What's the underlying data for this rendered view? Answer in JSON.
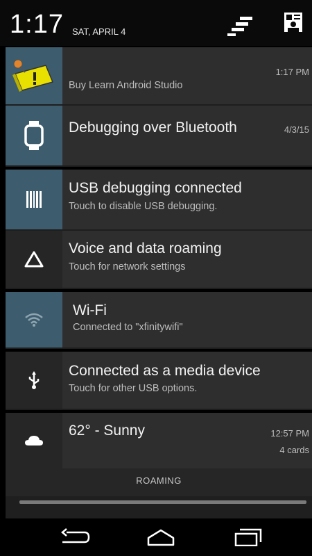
{
  "status_bar": {
    "time": "1:17",
    "date": "SAT, APRIL 4",
    "icons": [
      "quick-settings-icon",
      "user-profile-icon"
    ]
  },
  "notifications": [
    {
      "id": "buy",
      "title": "",
      "subtitle": "Buy Learn Android Studio",
      "time": "1:17 PM",
      "icon": "label-tag-icon",
      "icon_bg": "#3d5d6e"
    },
    {
      "id": "bt-debug",
      "title": "Debugging over Bluetooth",
      "subtitle": "",
      "time": "4/3/15",
      "icon": "smartwatch-icon",
      "icon_bg": "#3d5d6e"
    },
    {
      "id": "usb-debug",
      "title": "USB debugging connected",
      "subtitle": "Touch to disable USB debugging.",
      "time": "",
      "icon": "barcode-icon",
      "icon_bg": "#3d5d6e"
    },
    {
      "id": "roaming",
      "title": "Voice and data roaming",
      "subtitle": "Touch for network settings",
      "time": "",
      "icon": "warning-triangle-icon",
      "icon_bg": "#262626"
    },
    {
      "id": "wifi",
      "title": "Wi-Fi",
      "subtitle": "Connected to \"xfinitywifi\"",
      "time": "",
      "icon": "wifi-icon",
      "icon_bg": "#3d5d6e"
    },
    {
      "id": "media",
      "title": "Connected as a media device",
      "subtitle": "Touch for other USB options.",
      "time": "",
      "icon": "usb-icon",
      "icon_bg": "#262626"
    },
    {
      "id": "weather",
      "title": "62° - Sunny",
      "subtitle": "",
      "time": "12:57 PM",
      "extra": "4 cards",
      "icon": "cloud-icon",
      "icon_bg": "#262626"
    }
  ],
  "footer": {
    "roaming_label": "ROAMING"
  },
  "nav_bar": {
    "buttons": [
      "back-icon",
      "home-icon",
      "recents-icon"
    ]
  },
  "colors": {
    "panel": "#2e2e2e",
    "icon_blue": "#3d5d6e",
    "background": "#000000"
  }
}
